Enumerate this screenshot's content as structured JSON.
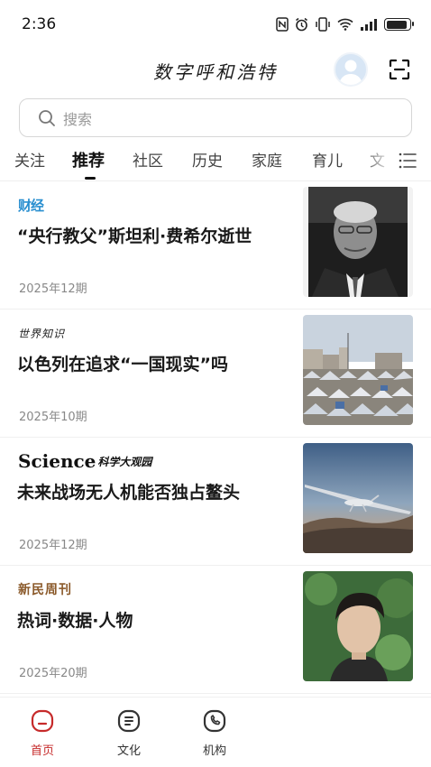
{
  "status_bar": {
    "time": "2:36",
    "icons": [
      "nfc-icon",
      "alarm-icon",
      "vibrate-icon",
      "wifi-icon",
      "signal-icon",
      "battery-icon"
    ],
    "battery_level": 0.9
  },
  "header": {
    "title": "数字呼和浩特",
    "avatar_icon": "avatar-icon",
    "scan_icon": "scan-icon"
  },
  "search": {
    "placeholder": "搜索"
  },
  "tabs": {
    "items": [
      {
        "label": "关注",
        "active": false
      },
      {
        "label": "推荐",
        "active": true
      },
      {
        "label": "社区",
        "active": false
      },
      {
        "label": "历史",
        "active": false
      },
      {
        "label": "家庭",
        "active": false
      },
      {
        "label": "育儿",
        "active": false
      },
      {
        "label": "文",
        "active": false
      }
    ],
    "menu_icon": "list-menu-icon"
  },
  "feed": [
    {
      "source": "财经",
      "title": "“央行教父”斯坦利·费希尔逝世",
      "date": "2025年12期",
      "thumb": "portrait-photo"
    },
    {
      "source": "世界知识",
      "title": "以色列在追求“一国现实”吗",
      "date": "2025年10期",
      "thumb": "tent-camp-photo"
    },
    {
      "source": "Science",
      "source_cn": "科学大观园",
      "title": "未来战场无人机能否独占鳌头",
      "date": "2025年12期",
      "thumb": "drone-photo"
    },
    {
      "source": "新民周刊",
      "title": "热词·数据·人物",
      "date": "2025年20期",
      "thumb": "man-portrait-photo"
    }
  ],
  "bottom_nav": [
    {
      "label": "首页",
      "icon": "home-icon",
      "active": true
    },
    {
      "label": "文化",
      "icon": "document-icon",
      "active": false
    },
    {
      "label": "机构",
      "icon": "phone-icon",
      "active": false
    }
  ],
  "colors": {
    "accent": "#c62a2a",
    "caijing_blue": "#2a8fd0",
    "text": "#1a1a1a",
    "muted": "#888888"
  }
}
